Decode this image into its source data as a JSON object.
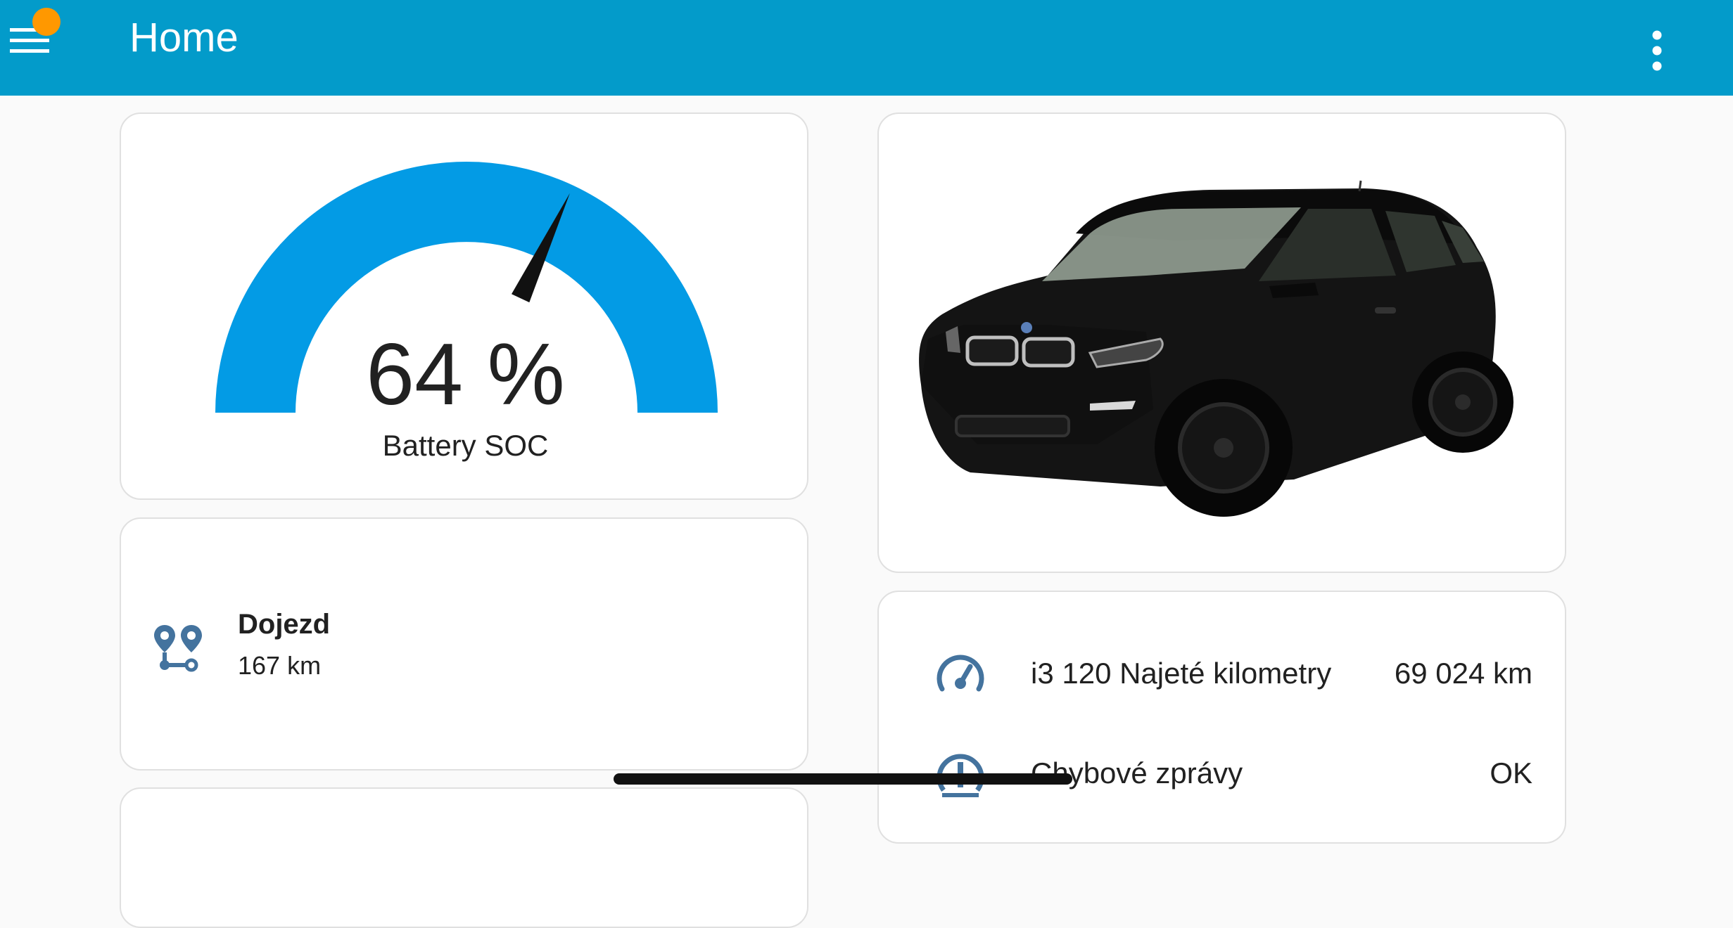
{
  "appbar": {
    "title": "Home",
    "bg_color": "#039bca",
    "notification_dot_color": "#ff9800",
    "menu_icon": "menu-icon",
    "more_icon": "more-vertical-icon"
  },
  "gauge": {
    "value": "64 %",
    "name": "Battery SOC",
    "level": 0.64,
    "color": "#039be5"
  },
  "car_image": {
    "icon": "car-image"
  },
  "range": {
    "icon": "map-marker-path-icon",
    "name": "Dojezd",
    "value": "167 km"
  },
  "entities": [
    {
      "icon": "speedometer-icon",
      "name": "i3 120 Najeté kilometry",
      "value": "69 024 km"
    },
    {
      "icon": "car-tire-alert-icon",
      "name": "Chybové zprávy",
      "value": "OK"
    }
  ],
  "icon_color": "#44739e"
}
